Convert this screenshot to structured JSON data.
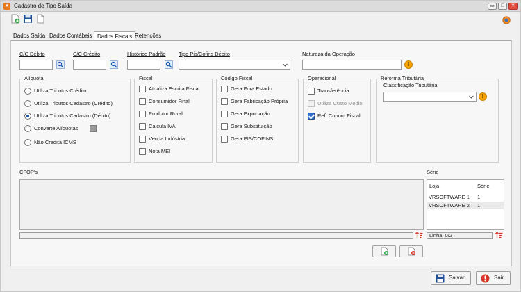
{
  "window": {
    "title": "Cadastro de Tipo Saída"
  },
  "tabs": [
    {
      "label": "Dados Saída"
    },
    {
      "label": "Dados Contábeis"
    },
    {
      "label": "Dados Fiscais"
    },
    {
      "label": "Retenções"
    }
  ],
  "active_tab": "Dados Fiscais",
  "fields": {
    "cc_debito": {
      "label": "C/C Débito",
      "value": ""
    },
    "cc_credito": {
      "label": "C/C Crédito",
      "value": ""
    },
    "historico_padrao": {
      "label": "Histórico Padrão",
      "value": ""
    },
    "tipo_pis_cofins": {
      "label": "Tipo Pis/Cofins Débito",
      "value": ""
    },
    "natureza_operacao": {
      "label": "Natureza da Operação",
      "value": ""
    }
  },
  "aliquota": {
    "title": "Alíquota",
    "options": [
      {
        "label": "Utiliza Tributos Crédito",
        "selected": false
      },
      {
        "label": "Utiliza Tributos Cadastro (Crédito)",
        "selected": false
      },
      {
        "label": "Utiliza Tributos Cadastro (Débito)",
        "selected": true
      },
      {
        "label": "Converte Alíquotas",
        "selected": false
      },
      {
        "label": "Não Credita ICMS",
        "selected": false
      }
    ]
  },
  "fiscal": {
    "title": "Fiscal",
    "options": [
      {
        "label": "Atualiza Escrita Fiscal",
        "checked": false
      },
      {
        "label": "Consumidor Final",
        "checked": false
      },
      {
        "label": "Produtor Rural",
        "checked": false
      },
      {
        "label": "Calcula IVA",
        "checked": false
      },
      {
        "label": "Venda Indústria",
        "checked": false
      },
      {
        "label": "Nota MEI",
        "checked": false
      }
    ]
  },
  "codigo_fiscal": {
    "title": "Código Fiscal",
    "options": [
      {
        "label": "Gera Fora Estado",
        "checked": false
      },
      {
        "label": "Gera Fabricação Própria",
        "checked": false
      },
      {
        "label": "Gera Exportação",
        "checked": false
      },
      {
        "label": "Gera Substituição",
        "checked": false
      },
      {
        "label": "Gera PIS/COFINS",
        "checked": false
      }
    ]
  },
  "operacional": {
    "title": "Operacional",
    "options": [
      {
        "label": "Transferência",
        "checked": false,
        "enabled": true
      },
      {
        "label": "Utiliza Custo Médio",
        "checked": false,
        "enabled": false
      },
      {
        "label": "Ref. Cupom Fiscal",
        "checked": true,
        "enabled": true
      }
    ]
  },
  "reforma": {
    "title": "Reforma Tributária",
    "classificacao_label": "Classificação Tributária",
    "classificacao_value": ""
  },
  "cfops": {
    "label": "CFOP's"
  },
  "serie": {
    "label": "Série",
    "columns": [
      "Loja",
      "Série"
    ],
    "rows": [
      {
        "loja": "VRSOFTWARE 1",
        "serie": "1"
      },
      {
        "loja": "VRSOFTWARE 2",
        "serie": "1"
      }
    ],
    "status": "Linha: 0/2"
  },
  "footer": {
    "save_label": "Salvar",
    "exit_label": "Sair"
  },
  "colors": {
    "accent_orange": "#e7791e",
    "check_blue": "#2f6fc8",
    "info_yellow": "#f5a300",
    "delete_red": "#d8352a",
    "add_green": "#2da84a"
  }
}
